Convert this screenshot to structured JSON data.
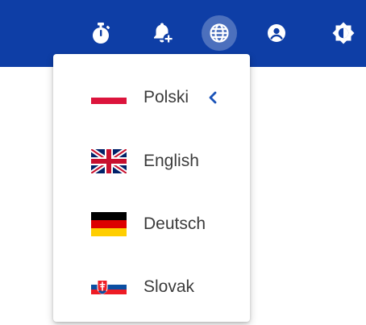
{
  "topbar": {
    "background": "#0e3ea6",
    "icons": [
      {
        "name": "stopwatch-icon"
      },
      {
        "name": "bell-plus-icon"
      },
      {
        "name": "globe-icon",
        "active": true
      },
      {
        "name": "account-circle-icon"
      },
      {
        "name": "brightness-icon"
      }
    ]
  },
  "language_menu": {
    "items": [
      {
        "label": "Polski",
        "flag": "poland-flag-icon",
        "selected": true,
        "indicator": "chevron-left-icon"
      },
      {
        "label": "English",
        "flag": "uk-flag-icon",
        "selected": false
      },
      {
        "label": "Deutsch",
        "flag": "germany-flag-icon",
        "selected": false
      },
      {
        "label": "Slovak",
        "flag": "slovakia-flag-icon",
        "selected": false
      }
    ]
  },
  "colors": {
    "accent": "#1a53b8",
    "text": "#3b3b3b"
  }
}
